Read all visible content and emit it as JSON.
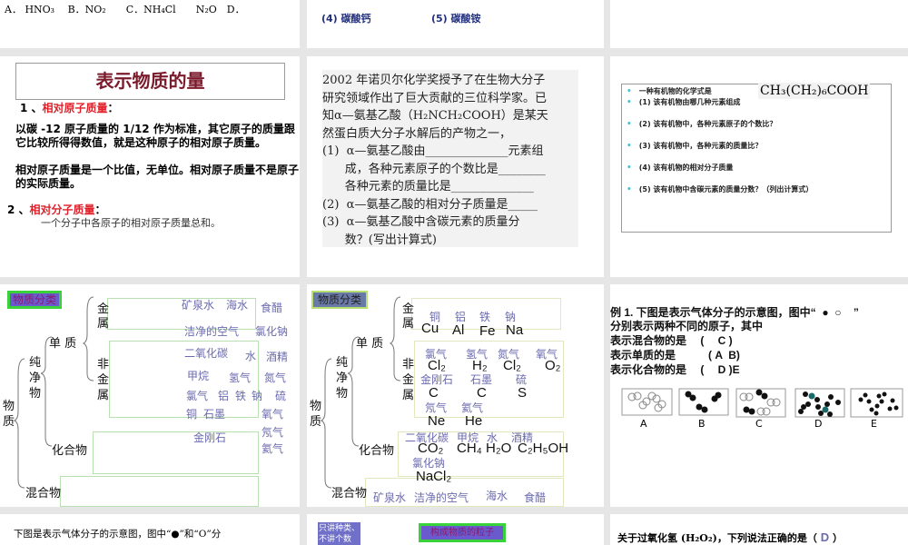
{
  "row0": {
    "s1": {
      "text": "A． HNO₃　 B．NO₂　　C．NH₄Cl　　N₂O　D．"
    },
    "s2": {
      "item4": "(4) 碳酸钙",
      "item5": "(5) 碳酸铵"
    }
  },
  "slide_relative_mass": {
    "title": "表示物质的量",
    "h1_num": "1 、",
    "h1": "相对原子质量",
    "colon": "：",
    "p1": "以碳 -12 原子质量的 1/12 作为标准，其它原子的质量跟它比较所得得数值，就是这种原子的相对原子质量。",
    "p2": "相对原子质量是一个比值，无单位。相对原子质量不是原子的实际质量。",
    "h2_num": "2 、",
    "h2": "相对分子质量",
    "p3": "一个分子中各原子的相对原子质量总和。"
  },
  "slide_glycine": {
    "lines": [
      "2002 年诺贝尔化学奖授予了在生物大分子",
      "研究领域作出了巨大贡献的三位科学家。已",
      "知α—氨基乙酸（H₂NCH₂COOH）是某天",
      "然蛋白质大分子水解后的产物之一，",
      "(1)  α—氨基乙酸由______________元素组",
      "      成，各种元素原子的个数比是________",
      "      各种元素的质量比是______________",
      "(2)  α—氨基乙酸的相对分子质量是_____",
      "(3)  α—氨基乙酸中含碳元素的质量分",
      "      数？(写出计算式)"
    ]
  },
  "slide_organic": {
    "formula": "CH₃(CH₂)₆COOH",
    "items": [
      "一种有机物的化学式是",
      "(1) 该有机物由哪几种元素组成",
      "(2) 该有机物中，各种元素原子的个数比？",
      "(3) 该有机物中，各种元素的质量比？",
      "(4) 该有机物的相对分子质量",
      "(5) 该有机物中含碳元素的质量分数？（列出计算式）"
    ],
    "bullet": "•"
  },
  "classify1": {
    "title": "物质分类",
    "labels": {
      "metal": "金属",
      "simple": "单 质",
      "nonmetal": "非金属",
      "pure": "纯净物",
      "matter": "物质",
      "compound": "化合物",
      "mixture": "混合物"
    },
    "words": [
      "矿泉水",
      "海水",
      "食醋",
      "洁净的空气",
      "氯化钠",
      "二氧化碳",
      "水",
      "酒精",
      "甲烷",
      "氢气",
      "氮气",
      "氯气",
      "铝",
      "铁",
      "钠",
      "硫",
      "铜",
      "石墨",
      "氧气",
      "金刚石",
      "氖气",
      "氦气"
    ]
  },
  "classify2": {
    "title": "物质分类",
    "metals": {
      "names": [
        "铜",
        "铝",
        "铁",
        "钠"
      ],
      "formulas": [
        "Cu",
        "Al",
        "Fe",
        "Na"
      ]
    },
    "nonmetals": {
      "names": [
        "氯气",
        "氢气",
        "氮气",
        "氧气",
        "金刚石",
        "石墨",
        "硫",
        "氖气",
        "氦气"
      ],
      "formulas": [
        "Cl₂",
        "H₂",
        "Cl₂",
        "O₂",
        "C",
        "C",
        "S",
        "Ne",
        "He"
      ]
    },
    "compounds": {
      "names": [
        "二氧化碳",
        "甲烷",
        "水",
        "酒精",
        "氯化钠"
      ],
      "formulas": [
        "CO₂",
        "CH₄",
        "H₂O",
        "C₂H₅OH",
        "NaCl₂"
      ]
    },
    "mixtures": [
      "矿泉水",
      "洁净的空气",
      "海水",
      "食醋"
    ]
  },
  "example1": {
    "lines": [
      "例 1. 下图是表示气体分子的示意图，图中“  ●  ○    ”",
      "分别表示两种不同的原子，其中",
      "表示混合物的是　 (　 C )",
      "表示单质的是　　　( A  B)",
      "表示化合物的是　 (　 D )E"
    ],
    "figs": [
      "A",
      "B",
      "C",
      "D",
      "E"
    ]
  },
  "row3": {
    "s1": "下图是表示气体分子的示意图，图中“●”和“O”分",
    "s2_note": "只讲种类、不讲个数",
    "s2_title": "构成物质的粒子",
    "s3_text": "关于过氧化氢 (H₂O₂)，下列说法正确的是（",
    "s3_answer": "D",
    "s3_end": "）"
  },
  "colors": {
    "accent_purple": "#6a6ab0",
    "title_red": "#7a1a2a",
    "heading_red": "#e0202a",
    "green": "#3ad23a"
  }
}
